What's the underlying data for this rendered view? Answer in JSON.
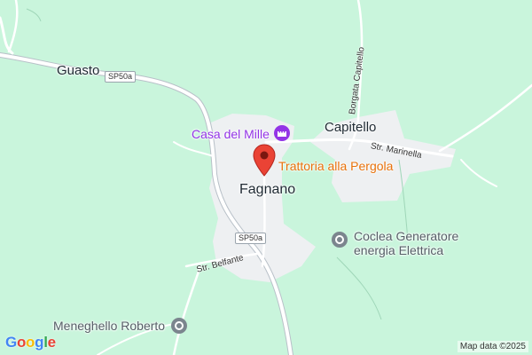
{
  "colors": {
    "background": "#c9f5dc",
    "town_area": "#eef0f2",
    "road": "#ffffff",
    "road_casing": "#b8c0c8",
    "poi_purple": "#9334e6",
    "poi_orange": "#e8710a",
    "pin_red": "#ea4335",
    "poi_grey": "#7b858e"
  },
  "places": {
    "guasto": "Guasto",
    "capitello": "Capitello",
    "fagnano": "Fagnano"
  },
  "roads": {
    "sp50a_north": "SP50a",
    "sp50a_south": "SP50a",
    "str_marinella": "Str. Marinella",
    "borgata_capitello": "Borgata Capitello",
    "str_belfante": "Str. Belfante"
  },
  "pois": {
    "casa_del_mille": {
      "name": "Casa del Mille",
      "icon": "castle-icon"
    },
    "trattoria": {
      "name": "Trattoria alla Pergola",
      "icon": "restaurant-pin-icon"
    },
    "coclea_line1": "Coclea Generatore",
    "coclea_line2": "energia Elettrica",
    "coclea_icon": "generic-poi-icon",
    "meneghello": {
      "name": "Meneghello Roberto",
      "icon": "generic-poi-icon"
    }
  },
  "footer": {
    "logo": "Google",
    "attribution": "Map data ©2025"
  }
}
